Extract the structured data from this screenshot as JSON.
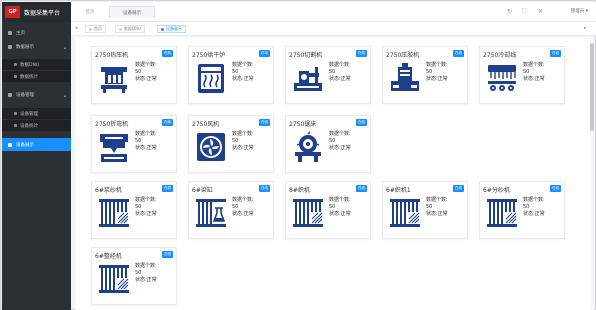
{
  "app": {
    "logo_text": "GP",
    "title": "数据采集平台"
  },
  "sidebar": {
    "items": [
      {
        "label": "主页"
      },
      {
        "label": "数据展示"
      },
      {
        "label": "数据DNU"
      },
      {
        "label": "数据统计"
      },
      {
        "label": "设备管理"
      },
      {
        "label": "设备管理"
      },
      {
        "label": "设备统计"
      },
      {
        "label": "设备展示"
      }
    ]
  },
  "topbar": {
    "home_tab": "首页",
    "active_tab": "设备展示",
    "refresh_icon": "↻",
    "fullscreen_icon": "⛶",
    "close_icon": "✕",
    "user": "管理员 ▾"
  },
  "tags": [
    {
      "label": "首页"
    },
    {
      "label": "数据DNU"
    },
    {
      "label": "设备展示"
    }
  ],
  "card_info": {
    "line1": "数据个数:",
    "line2": "50",
    "line3": "状态:正常"
  },
  "cards": [
    {
      "title": "2750热压机",
      "badge": "在线",
      "icon": "press"
    },
    {
      "title": "2750烘干炉",
      "badge": "在线",
      "icon": "oven"
    },
    {
      "title": "2750切割机",
      "badge": "在线",
      "icon": "cutter"
    },
    {
      "title": "2750压胶机",
      "badge": "在线",
      "icon": "extruder"
    },
    {
      "title": "2750冷却线",
      "badge": "在线",
      "icon": "cooling"
    },
    {
      "title": "2750折弯机",
      "badge": "在线",
      "icon": "bender"
    },
    {
      "title": "2750风机",
      "badge": "在线",
      "icon": "fan"
    },
    {
      "title": "2750锯床",
      "badge": "在线",
      "icon": "saw"
    },
    {
      "title": "6#浆纱机",
      "badge": "在线",
      "icon": "loom"
    },
    {
      "title": "6#染缸",
      "badge": "在线",
      "icon": "dye"
    },
    {
      "title": "8#织机",
      "badge": "在线",
      "icon": "loom"
    },
    {
      "title": "6#织机1",
      "badge": "在线",
      "icon": "loom"
    },
    {
      "title": "6#分纱机",
      "badge": "在线",
      "icon": "loom"
    },
    {
      "title": "6#整经机",
      "badge": "在线",
      "icon": "loom"
    }
  ]
}
